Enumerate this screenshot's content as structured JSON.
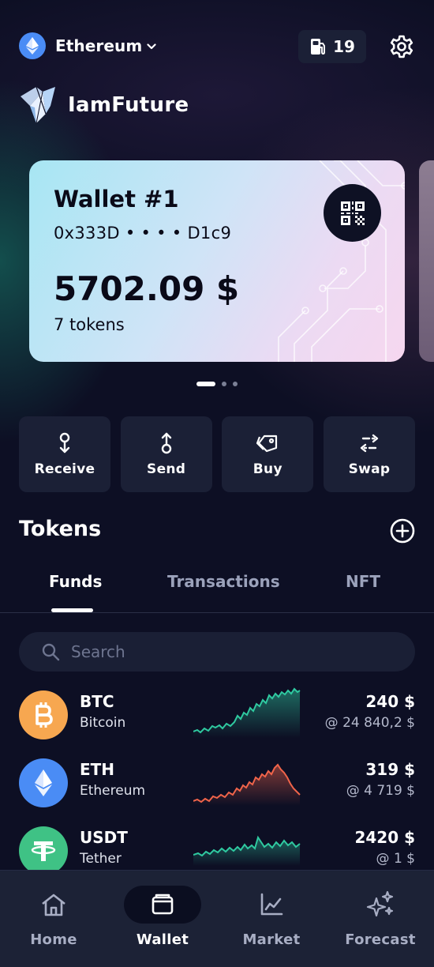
{
  "header": {
    "network": "Ethereum",
    "network_icon": "ethereum-icon",
    "gas_count": "19",
    "gas_icon": "fuel-pump-icon",
    "settings_icon": "gear-icon"
  },
  "brand": {
    "name": "IamFuture",
    "logo_icon": "butterfly-logo-icon"
  },
  "wallet_card": {
    "title": "Wallet #1",
    "address": "0x333D • • • • D1c9",
    "balance": "5702.09 $",
    "tokens": "7 tokens",
    "qr_icon": "qr-code-icon"
  },
  "pager": {
    "pages": 3,
    "active": 0
  },
  "actions": [
    {
      "label": "Receive",
      "icon": "receive-icon"
    },
    {
      "label": "Send",
      "icon": "send-icon"
    },
    {
      "label": "Buy",
      "icon": "tag-icon"
    },
    {
      "label": "Swap",
      "icon": "swap-icon"
    }
  ],
  "tokens_section": {
    "title": "Tokens",
    "add_icon": "plus-circle-icon",
    "tabs": [
      "Funds",
      "Transactions",
      "NFT"
    ],
    "active_tab": "Funds",
    "search_placeholder": "Search"
  },
  "tokens": [
    {
      "symbol": "BTC",
      "name": "Bitcoin",
      "amount": "240 $",
      "price": "@ 24 840,2 $",
      "color": "#f7a750",
      "trend_color": "#2fc9a0",
      "icon": "bitcoin-icon"
    },
    {
      "symbol": "ETH",
      "name": "Ethereum",
      "amount": "319 $",
      "price": "@ 4 719 $",
      "color": "#4a8cf5",
      "trend_color": "#f0644a",
      "icon": "ethereum-icon"
    },
    {
      "symbol": "USDT",
      "name": "Tether",
      "amount": "2420 $",
      "price": "@ 1 $",
      "color": "#3fc285",
      "trend_color": "#2fc9a0",
      "icon": "tether-icon"
    }
  ],
  "bottom_nav": [
    {
      "label": "Home",
      "icon": "home-icon"
    },
    {
      "label": "Wallet",
      "icon": "wallet-icon"
    },
    {
      "label": "Market",
      "icon": "chart-line-icon"
    },
    {
      "label": "Forecast",
      "icon": "sparkles-icon"
    }
  ],
  "bottom_nav_active": "Wallet"
}
